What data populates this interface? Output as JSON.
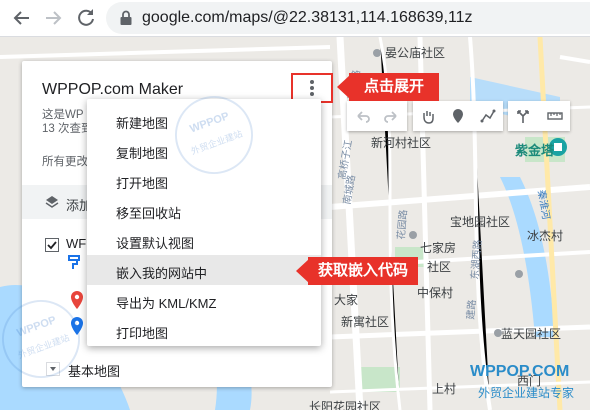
{
  "browser": {
    "url": "google.com/maps/@22.38131,114.168639,11z",
    "back_icon": "arrow-left-icon",
    "forward_icon": "arrow-right-icon",
    "reload_icon": "reload-icon",
    "lock_icon": "lock-icon"
  },
  "panel": {
    "title": "WPPOP.com Maker",
    "description_line1": "这是WP",
    "description_line2": "13 次查到",
    "saved_status": "所有更改",
    "add_layer_label": "添加",
    "layer_name": "WF",
    "base_map_label": "基本地图"
  },
  "menu": {
    "items": [
      "新建地图",
      "复制地图",
      "打开地图",
      "移至回收站",
      "设置默认视图",
      "嵌入我的网站中",
      "导出为 KML/KMZ",
      "打印地图"
    ],
    "highlighted_index": 5
  },
  "callouts": {
    "menu_button": "点击展开",
    "embed": "获取嵌入代码"
  },
  "map": {
    "labels": {
      "l1": "晏公庙社区",
      "l2": "新河村社区",
      "l3": "紫金塔",
      "l4": "宝地园社区",
      "l5": "冰杰村",
      "l6": "七家房",
      "l7": "社区",
      "l8": "中保村",
      "l9": "大家",
      "l10": "新寓社区",
      "l11": "蓝天园社区",
      "l12": "上村",
      "l13": "长阳花园社区",
      "l14": "西门",
      "road1": "西秀路",
      "road2": "高桥子江",
      "road3": "南城路",
      "road4": "花园路",
      "road5": "建路",
      "road6": "东湖西路",
      "road7": "秦淮河"
    }
  },
  "watermark": {
    "brand": "WPPOP.COM",
    "tagline": "外贸企业建站专家",
    "stamp_top": "WPPOP",
    "stamp_bottom": "外贸企业建站"
  },
  "colors": {
    "callout": "#e8322a",
    "map_bg": "#eceae6",
    "water": "#aadaff",
    "park": "#c8e6c9"
  }
}
